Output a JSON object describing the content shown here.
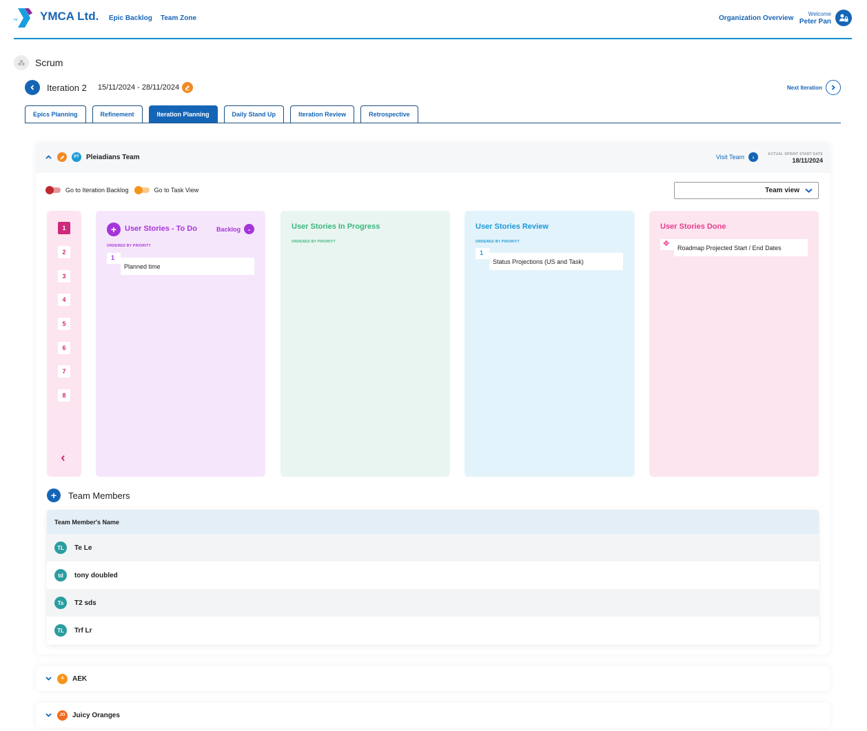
{
  "brand": {
    "name": "YMCA Ltd."
  },
  "nav": {
    "links": [
      "Epic Backlog",
      "Team Zone"
    ],
    "org_overview": "Organization Overview",
    "welcome_label": "Welcome",
    "user_name": "Peter Pan"
  },
  "page": {
    "title": "Scrum"
  },
  "iteration": {
    "name": "Iteration 2",
    "start": "15/11/2024",
    "separator": "-",
    "end": "28/11/2024",
    "next_label": "Next Iteration"
  },
  "tabs": [
    {
      "label": "Epics Planning",
      "active": false
    },
    {
      "label": "Refinement",
      "active": false
    },
    {
      "label": "Iteration Planning",
      "active": true
    },
    {
      "label": "Daily Stand Up",
      "active": false
    },
    {
      "label": "Iteration Review",
      "active": false
    },
    {
      "label": "Retrospective",
      "active": false
    }
  ],
  "team": {
    "name": "Pleiadians Team",
    "initials": "PT",
    "visit_label": "Visit Team",
    "sprint_start_label": "ACTUAL SPRINT START DATE",
    "sprint_start_value": "18/11/2024",
    "toggles": [
      {
        "label": "Go to Iteration Backlog",
        "color": "#c0282f"
      },
      {
        "label": "Go to Task View",
        "color": "#f7941d"
      }
    ],
    "view_select": "Team view",
    "pages": [
      "1",
      "2",
      "3",
      "4",
      "5",
      "6",
      "7",
      "8"
    ],
    "active_page": "1",
    "columns": [
      {
        "title": "User Stories - To Do",
        "ordered_label": "ORDERED BY PRIORITY",
        "backlog_label": "Backlog",
        "accent": "#a535d9",
        "bg": "#f6e6fb",
        "cards": [
          {
            "num": "1",
            "title": "Planned time"
          }
        ]
      },
      {
        "title": "User Stories In Progress",
        "ordered_label": "ORDERED BY PRIORITY",
        "accent": "#3bb77e",
        "bg": "#e9f5f1",
        "cards": []
      },
      {
        "title": "User Stories Review",
        "ordered_label": "ORDERED BY PRIORITY",
        "accent": "#1c9ad6",
        "bg": "#e3f3fb",
        "cards": [
          {
            "num": "1",
            "title": "Status Projections (US and Task)"
          }
        ]
      },
      {
        "title": "User Stories Done",
        "accent": "#e63c8d",
        "bg": "#fde5f0",
        "cards": [
          {
            "icon": "move-icon",
            "title": "Roadmap Projected Start / End Dates"
          }
        ]
      }
    ],
    "members_title": "Team Members",
    "members_header": "Team Member's Name",
    "members": [
      {
        "initials": "TL",
        "name": "Te Le"
      },
      {
        "initials": "td",
        "name": "tony doubled"
      },
      {
        "initials": "Ts",
        "name": "T2 sds"
      },
      {
        "initials": "TL",
        "name": "Trf Lr"
      }
    ]
  },
  "other_teams": [
    {
      "initials": "A",
      "name": "AEK",
      "color": "#f7941d"
    },
    {
      "initials": "JO",
      "name": "Juicy Oranges",
      "color": "#f26a1b"
    }
  ]
}
